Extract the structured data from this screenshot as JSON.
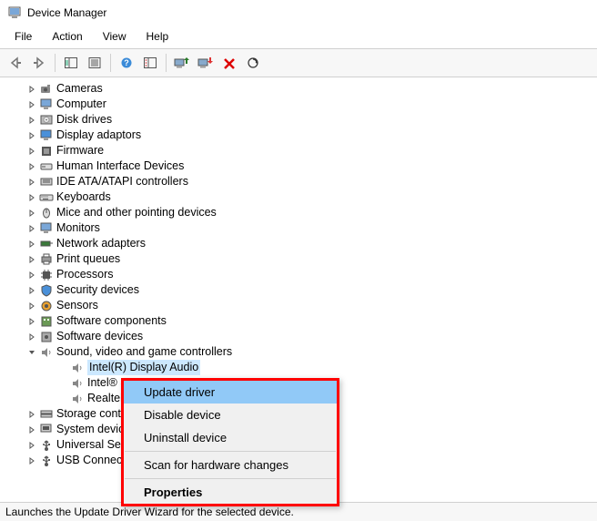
{
  "window": {
    "title": "Device Manager"
  },
  "menubar": [
    "File",
    "Action",
    "View",
    "Help"
  ],
  "tree": {
    "items": [
      {
        "label": "Cameras"
      },
      {
        "label": "Computer"
      },
      {
        "label": "Disk drives"
      },
      {
        "label": "Display adaptors"
      },
      {
        "label": "Firmware"
      },
      {
        "label": "Human Interface Devices"
      },
      {
        "label": "IDE ATA/ATAPI controllers"
      },
      {
        "label": "Keyboards"
      },
      {
        "label": "Mice and other pointing devices"
      },
      {
        "label": "Monitors"
      },
      {
        "label": "Network adapters"
      },
      {
        "label": "Print queues"
      },
      {
        "label": "Processors"
      },
      {
        "label": "Security devices"
      },
      {
        "label": "Sensors"
      },
      {
        "label": "Software components"
      },
      {
        "label": "Software devices"
      }
    ],
    "expanded": {
      "label": "Sound, video and game controllers",
      "children": [
        {
          "label": "Intel(R) Display Audio",
          "selected": true
        },
        {
          "label": "Intel® Sm"
        },
        {
          "label": "Realtek(R)"
        }
      ]
    },
    "after": [
      {
        "label": "Storage contr"
      },
      {
        "label": "System device"
      },
      {
        "label": "Universal Seri"
      },
      {
        "label": "USB Connecto"
      }
    ]
  },
  "context_menu": {
    "items": [
      {
        "label": "Update driver",
        "highlighted": true
      },
      {
        "label": "Disable device"
      },
      {
        "label": "Uninstall device"
      },
      {
        "sep": true
      },
      {
        "label": "Scan for hardware changes"
      },
      {
        "sep": true
      },
      {
        "label": "Properties",
        "bold": true
      }
    ]
  },
  "status": "Launches the Update Driver Wizard for the selected device."
}
